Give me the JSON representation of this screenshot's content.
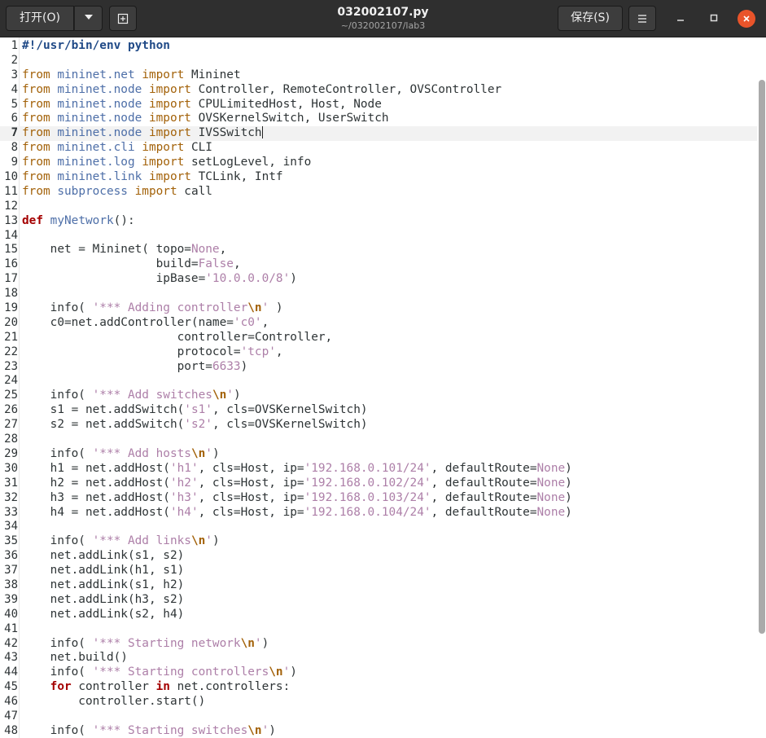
{
  "toolbar": {
    "open_label": "打开(O)",
    "save_label": "保存(S)"
  },
  "window": {
    "title": "032002107.py",
    "subtitle": "~/032002107/lab3"
  },
  "icons": {
    "open_menu": "chevron-down-icon",
    "new_doc": "new-document-icon",
    "hamburger": "menu-icon",
    "minimize": "minimize-icon",
    "maximize": "maximize-icon",
    "close": "close-icon"
  },
  "colors": {
    "titlebar": "#2f2f2f",
    "close_button": "#e9542a",
    "keyword": "#a3620a",
    "def_keyword": "#a40000",
    "module": "#4e6fa8",
    "string": "#ad7fa8"
  },
  "editor": {
    "current_line": 7,
    "lines": [
      [
        {
          "t": "#!/usr/bin/env python",
          "c": "shebang"
        }
      ],
      [],
      [
        {
          "t": "from",
          "c": "kw"
        },
        {
          "t": " "
        },
        {
          "t": "mininet.net",
          "c": "mod"
        },
        {
          "t": " "
        },
        {
          "t": "import",
          "c": "kw"
        },
        {
          "t": " Mininet"
        }
      ],
      [
        {
          "t": "from",
          "c": "kw"
        },
        {
          "t": " "
        },
        {
          "t": "mininet.node",
          "c": "mod"
        },
        {
          "t": " "
        },
        {
          "t": "import",
          "c": "kw"
        },
        {
          "t": " Controller, RemoteController, OVSController"
        }
      ],
      [
        {
          "t": "from",
          "c": "kw"
        },
        {
          "t": " "
        },
        {
          "t": "mininet.node",
          "c": "mod"
        },
        {
          "t": " "
        },
        {
          "t": "import",
          "c": "kw"
        },
        {
          "t": " CPULimitedHost, Host, Node"
        }
      ],
      [
        {
          "t": "from",
          "c": "kw"
        },
        {
          "t": " "
        },
        {
          "t": "mininet.node",
          "c": "mod"
        },
        {
          "t": " "
        },
        {
          "t": "import",
          "c": "kw"
        },
        {
          "t": " OVSKernelSwitch, UserSwitch"
        }
      ],
      [
        {
          "t": "from",
          "c": "kw"
        },
        {
          "t": " "
        },
        {
          "t": "mininet.node",
          "c": "mod"
        },
        {
          "t": " "
        },
        {
          "t": "import",
          "c": "kw"
        },
        {
          "t": " IVSSwitch"
        }
      ],
      [
        {
          "t": "from",
          "c": "kw"
        },
        {
          "t": " "
        },
        {
          "t": "mininet.cli",
          "c": "mod"
        },
        {
          "t": " "
        },
        {
          "t": "import",
          "c": "kw"
        },
        {
          "t": " CLI"
        }
      ],
      [
        {
          "t": "from",
          "c": "kw"
        },
        {
          "t": " "
        },
        {
          "t": "mininet.log",
          "c": "mod"
        },
        {
          "t": " "
        },
        {
          "t": "import",
          "c": "kw"
        },
        {
          "t": " setLogLevel, info"
        }
      ],
      [
        {
          "t": "from",
          "c": "kw"
        },
        {
          "t": " "
        },
        {
          "t": "mininet.link",
          "c": "mod"
        },
        {
          "t": " "
        },
        {
          "t": "import",
          "c": "kw"
        },
        {
          "t": " TCLink, Intf"
        }
      ],
      [
        {
          "t": "from",
          "c": "kw"
        },
        {
          "t": " "
        },
        {
          "t": "subprocess",
          "c": "mod"
        },
        {
          "t": " "
        },
        {
          "t": "import",
          "c": "kw"
        },
        {
          "t": " call"
        }
      ],
      [],
      [
        {
          "t": "def",
          "c": "kw2"
        },
        {
          "t": " "
        },
        {
          "t": "myNetwork",
          "c": "func"
        },
        {
          "t": "():"
        }
      ],
      [],
      [
        {
          "t": "    net = Mininet( topo="
        },
        {
          "t": "None",
          "c": "cnst"
        },
        {
          "t": ","
        }
      ],
      [
        {
          "t": "                   build="
        },
        {
          "t": "False",
          "c": "cnst"
        },
        {
          "t": ","
        }
      ],
      [
        {
          "t": "                   ipBase="
        },
        {
          "t": "'10.0.0.0/8'",
          "c": "str"
        },
        {
          "t": ")"
        }
      ],
      [],
      [
        {
          "t": "    info( "
        },
        {
          "t": "'*** Adding controller",
          "c": "str"
        },
        {
          "t": "\\n",
          "c": "esc"
        },
        {
          "t": "'",
          "c": "str"
        },
        {
          "t": " )"
        }
      ],
      [
        {
          "t": "    c0=net.addController(name="
        },
        {
          "t": "'c0'",
          "c": "str"
        },
        {
          "t": ","
        }
      ],
      [
        {
          "t": "                      controller=Controller,"
        }
      ],
      [
        {
          "t": "                      protocol="
        },
        {
          "t": "'tcp'",
          "c": "str"
        },
        {
          "t": ","
        }
      ],
      [
        {
          "t": "                      port="
        },
        {
          "t": "6633",
          "c": "num"
        },
        {
          "t": ")"
        }
      ],
      [],
      [
        {
          "t": "    info( "
        },
        {
          "t": "'*** Add switches",
          "c": "str"
        },
        {
          "t": "\\n",
          "c": "esc"
        },
        {
          "t": "'",
          "c": "str"
        },
        {
          "t": ")"
        }
      ],
      [
        {
          "t": "    s1 = net.addSwitch("
        },
        {
          "t": "'s1'",
          "c": "str"
        },
        {
          "t": ", cls=OVSKernelSwitch)"
        }
      ],
      [
        {
          "t": "    s2 = net.addSwitch("
        },
        {
          "t": "'s2'",
          "c": "str"
        },
        {
          "t": ", cls=OVSKernelSwitch)"
        }
      ],
      [],
      [
        {
          "t": "    info( "
        },
        {
          "t": "'*** Add hosts",
          "c": "str"
        },
        {
          "t": "\\n",
          "c": "esc"
        },
        {
          "t": "'",
          "c": "str"
        },
        {
          "t": ")"
        }
      ],
      [
        {
          "t": "    h1 = net.addHost("
        },
        {
          "t": "'h1'",
          "c": "str"
        },
        {
          "t": ", cls=Host, ip="
        },
        {
          "t": "'192.168.0.101/24'",
          "c": "str"
        },
        {
          "t": ", defaultRoute="
        },
        {
          "t": "None",
          "c": "cnst"
        },
        {
          "t": ")"
        }
      ],
      [
        {
          "t": "    h2 = net.addHost("
        },
        {
          "t": "'h2'",
          "c": "str"
        },
        {
          "t": ", cls=Host, ip="
        },
        {
          "t": "'192.168.0.102/24'",
          "c": "str"
        },
        {
          "t": ", defaultRoute="
        },
        {
          "t": "None",
          "c": "cnst"
        },
        {
          "t": ")"
        }
      ],
      [
        {
          "t": "    h3 = net.addHost("
        },
        {
          "t": "'h3'",
          "c": "str"
        },
        {
          "t": ", cls=Host, ip="
        },
        {
          "t": "'192.168.0.103/24'",
          "c": "str"
        },
        {
          "t": ", defaultRoute="
        },
        {
          "t": "None",
          "c": "cnst"
        },
        {
          "t": ")"
        }
      ],
      [
        {
          "t": "    h4 = net.addHost("
        },
        {
          "t": "'h4'",
          "c": "str"
        },
        {
          "t": ", cls=Host, ip="
        },
        {
          "t": "'192.168.0.104/24'",
          "c": "str"
        },
        {
          "t": ", defaultRoute="
        },
        {
          "t": "None",
          "c": "cnst"
        },
        {
          "t": ")"
        }
      ],
      [],
      [
        {
          "t": "    info( "
        },
        {
          "t": "'*** Add links",
          "c": "str"
        },
        {
          "t": "\\n",
          "c": "esc"
        },
        {
          "t": "'",
          "c": "str"
        },
        {
          "t": ")"
        }
      ],
      [
        {
          "t": "    net.addLink(s1, s2)"
        }
      ],
      [
        {
          "t": "    net.addLink(h1, s1)"
        }
      ],
      [
        {
          "t": "    net.addLink(s1, h2)"
        }
      ],
      [
        {
          "t": "    net.addLink(h3, s2)"
        }
      ],
      [
        {
          "t": "    net.addLink(s2, h4)"
        }
      ],
      [],
      [
        {
          "t": "    info( "
        },
        {
          "t": "'*** Starting network",
          "c": "str"
        },
        {
          "t": "\\n",
          "c": "esc"
        },
        {
          "t": "'",
          "c": "str"
        },
        {
          "t": ")"
        }
      ],
      [
        {
          "t": "    net.build()"
        }
      ],
      [
        {
          "t": "    info( "
        },
        {
          "t": "'*** Starting controllers",
          "c": "str"
        },
        {
          "t": "\\n",
          "c": "esc"
        },
        {
          "t": "'",
          "c": "str"
        },
        {
          "t": ")"
        }
      ],
      [
        {
          "t": "    "
        },
        {
          "t": "for",
          "c": "kw2"
        },
        {
          "t": " controller "
        },
        {
          "t": "in",
          "c": "kw2"
        },
        {
          "t": " net.controllers:"
        }
      ],
      [
        {
          "t": "        controller.start()"
        }
      ],
      [],
      [
        {
          "t": "    info( "
        },
        {
          "t": "'*** Starting switches",
          "c": "str"
        },
        {
          "t": "\\n",
          "c": "esc"
        },
        {
          "t": "'",
          "c": "str"
        },
        {
          "t": ")"
        }
      ]
    ]
  }
}
